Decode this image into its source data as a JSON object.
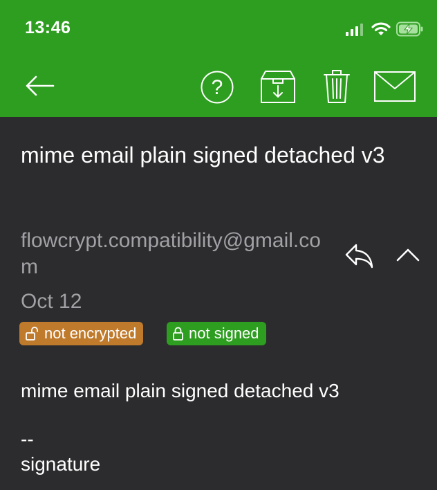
{
  "status_bar": {
    "time": "13:46",
    "icons": [
      "signal-icon",
      "wifi-icon",
      "battery-charging-icon"
    ]
  },
  "toolbar": {
    "back_icon": "arrow-left-icon",
    "actions": [
      "help-icon",
      "archive-icon",
      "trash-icon",
      "mail-icon"
    ]
  },
  "message": {
    "subject": "mime email plain signed detached v3",
    "sender": "flowcrypt.compatibility@gmail.com",
    "date": "Oct 12",
    "badges": {
      "encryption": "not encrypted",
      "signature": "not signed"
    },
    "body_line1": "mime email plain signed detached v3",
    "body_line2": "--",
    "body_line3": "signature"
  },
  "colors": {
    "header_green": "#2e9e20",
    "background": "#2c2c2e",
    "badge_orange": "#c07a2b",
    "badge_green": "#2e9e20",
    "muted_text": "#a1a1a6"
  }
}
